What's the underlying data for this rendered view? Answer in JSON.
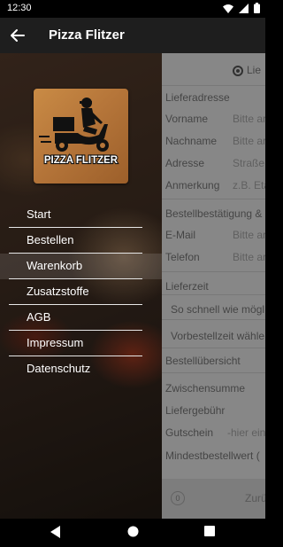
{
  "status_bar": {
    "time": "12:30"
  },
  "app_bar": {
    "title": "Pizza Flitzer"
  },
  "logo": {
    "text": "PIZZA FLITZER"
  },
  "menu": {
    "items": [
      {
        "label": "Start"
      },
      {
        "label": "Bestellen"
      },
      {
        "label": "Warenkorb"
      },
      {
        "label": "Zusatzstoffe"
      },
      {
        "label": "AGB"
      },
      {
        "label": "Impressum"
      },
      {
        "label": "Datenschutz"
      }
    ]
  },
  "form": {
    "delivery_option": "Lie",
    "address_heading": "Lieferadresse",
    "first_name": {
      "label": "Vorname",
      "placeholder": "Bitte ar"
    },
    "last_name": {
      "label": "Nachname",
      "placeholder": "Bitte ar"
    },
    "address": {
      "label": "Adresse",
      "placeholder": "Straße"
    },
    "note": {
      "label": "Anmerkung",
      "placeholder": "z.B. Eta"
    },
    "confirmation_heading": "Bestellbestätigung &",
    "email": {
      "label": "E-Mail",
      "placeholder": "Bitte ar"
    },
    "phone": {
      "label": "Telefon",
      "placeholder": "Bitte ar"
    },
    "delivery_time_heading": "Lieferzeit",
    "asap": "So schnell wie mögl",
    "preorder": "Vorbestellzeit wähle",
    "summary_heading": "Bestellübersicht",
    "subtotal": "Zwischensumme",
    "delivery_fee": "Liefergebühr",
    "voucher": {
      "label": "Gutschein",
      "placeholder": "-hier ein"
    },
    "min_order": "Mindestbestellwert (",
    "footer": {
      "count": "0",
      "back": "Zurü"
    }
  }
}
